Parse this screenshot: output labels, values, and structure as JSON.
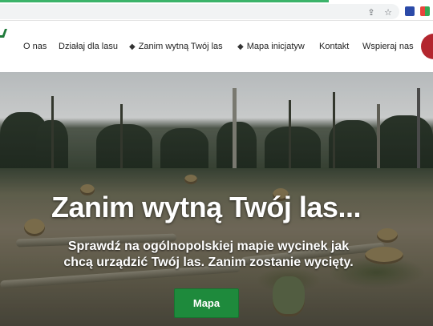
{
  "browser": {
    "icons": [
      "share-icon",
      "star-icon",
      "extension-icon",
      "extension-icon"
    ]
  },
  "nav": {
    "items": [
      {
        "label": "O nas",
        "icon": ""
      },
      {
        "label": "Działaj dla lasu",
        "icon": ""
      },
      {
        "label": "Zanim wytną Twój las",
        "icon": "map-marker-icon"
      },
      {
        "label": "Mapa inicjatyw",
        "icon": "map-marker-icon"
      },
      {
        "label": "Kontakt",
        "icon": ""
      },
      {
        "label": "Wspieraj nas",
        "icon": ""
      }
    ],
    "accent": "#b3262e",
    "brand_color": "#1f7a3a"
  },
  "hero": {
    "title": "Zanim wytną Twój las...",
    "subtitle_line1": "Sprawdź na ogólnopolskiej mapie wycinek jak",
    "subtitle_line2": "chcą urządzić Twój las. Zanim zostanie wycięty.",
    "cta_label": "Mapa",
    "cta_color": "#1e8a3c"
  }
}
